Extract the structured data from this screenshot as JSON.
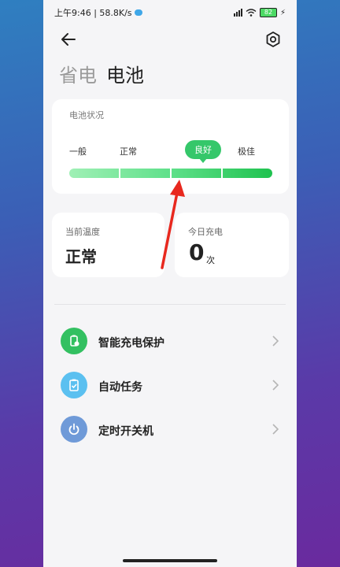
{
  "status_bar": {
    "time_speed": "上午9:46 | 58.8K/s",
    "battery_level": "82"
  },
  "tabs": {
    "inactive": "省电",
    "active": "电池"
  },
  "battery_status": {
    "title": "电池状况",
    "levels": [
      "一般",
      "正常",
      "良好",
      "极佳"
    ],
    "current_level": "良好"
  },
  "temperature": {
    "label": "当前温度",
    "value": "正常"
  },
  "charging": {
    "label": "今日充电",
    "count": "0",
    "unit": "次"
  },
  "menu": [
    {
      "label": "智能充电保护",
      "icon": "battery-shield-icon",
      "color": "#33c061"
    },
    {
      "label": "自动任务",
      "icon": "clipboard-check-icon",
      "color": "#5bc0f0"
    },
    {
      "label": "定时开关机",
      "icon": "power-icon",
      "color": "#6f9ad8"
    }
  ],
  "colors": {
    "accent_green": "#35c76a",
    "annotation_arrow": "#e8281e"
  }
}
